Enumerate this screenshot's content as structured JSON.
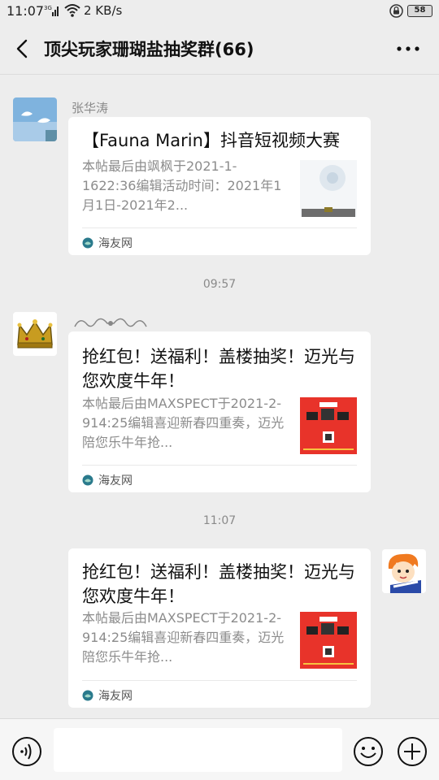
{
  "status_bar": {
    "time": "11:07",
    "network_speed": "2 KB/s",
    "battery": "58"
  },
  "header": {
    "title": "顶尖玩家珊瑚盐抽奖群(66)"
  },
  "messages": [
    {
      "sender": "张华涛",
      "card": {
        "title": "【Fauna Marin】抖音短视频大赛",
        "description": "本帖最后由飒枫于2021-1-1622:36编辑活动时间：2021年1月1日-2021年2...",
        "source": "海友网"
      }
    },
    {
      "timestamp": "09:57",
      "sender": "",
      "card": {
        "title": "抢红包！送福利！盖楼抽奖！迈光与您欢度牛年！",
        "description": "本帖最后由MAXSPECT于2021-2-914:25编辑喜迎新春四重奏，迈光陪您乐牛年抢...",
        "source": "海友网"
      }
    },
    {
      "timestamp": "11:07",
      "card": {
        "title": "抢红包！送福利！盖楼抽奖！迈光与您欢度牛年！",
        "description": "本帖最后由MAXSPECT于2021-2-914:25编辑喜迎新春四重奏，迈光陪您乐牛年抢...",
        "source": "海友网"
      }
    }
  ],
  "input_bar": {
    "placeholder": "",
    "icons": [
      "voice-icon",
      "emoji-icon",
      "plus-icon"
    ]
  },
  "colors": {
    "background": "#ededed",
    "card": "#ffffff",
    "meta_text": "#8a8a8a",
    "source_icon": "#2a7a8c"
  }
}
